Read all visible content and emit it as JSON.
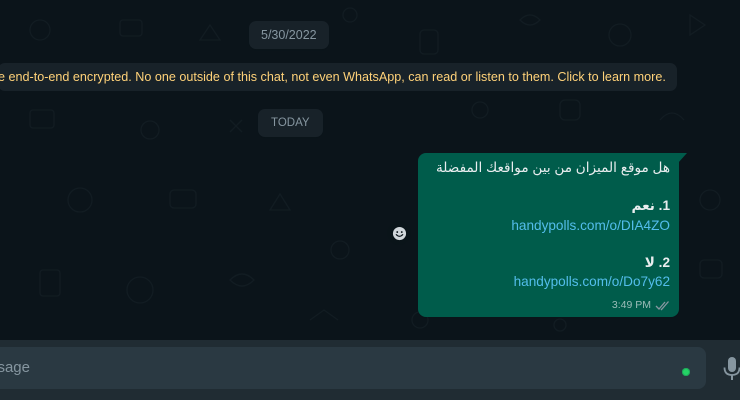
{
  "chat": {
    "date_chip": "5/30/2022",
    "encryption_notice": "e end-to-end encrypted. No one outside of this chat, not even WhatsApp, can read or listen to them. Click to learn more.",
    "today_chip": "TODAY"
  },
  "message": {
    "question": "هل موقع الميزان من بين مواقعك المفضلة",
    "option1_label": "1. نعم",
    "option1_link": "handypolls.com/o/DIA4ZO",
    "option2_label": "2. لا",
    "option2_link": "handypolls.com/o/Do7y62",
    "time": "3:49 PM"
  },
  "composer": {
    "placeholder": "essage"
  },
  "colors": {
    "background": "#0b141a",
    "outgoing_bubble": "#005c4b",
    "link": "#53bdeb",
    "system_notice": "#ffd279",
    "composer_bar": "#202c33",
    "composer_input": "#2a3942"
  },
  "icons": {
    "reaction": "emoji-icon",
    "read_receipt": "double-check-icon",
    "voice": "microphone-icon",
    "status": "green-dot-icon"
  }
}
